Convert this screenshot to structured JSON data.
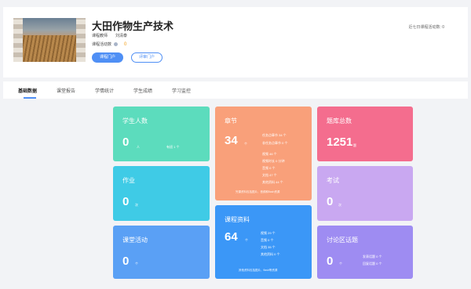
{
  "course": {
    "title": "大田作物生产技术",
    "teacher_label": "课程教师",
    "teacher_name": "刘清泰",
    "activity_label": "课程活动数",
    "activity_count": "0",
    "btn_course_portal": "课程门户",
    "btn_eval_portal": "评审门户",
    "recent_stat": "近七日课程活动数: 0"
  },
  "tabs": [
    "基础数据",
    "课堂报告",
    "学情统计",
    "学生成绩",
    "学习监控"
  ],
  "cards": {
    "students": {
      "title": "学生人数",
      "value": "0",
      "unit": "人",
      "sub": "有班 1 个"
    },
    "chapters": {
      "title": "章节",
      "value": "34",
      "unit": "个",
      "lines": [
        "任务点章节 34 个",
        "非任务点章节 0 个",
        "视频 46 个",
        "视频时长 0 分钟",
        "音频 0 个",
        "文档 47 个",
        "其他资料 44 个"
      ],
      "foot": "完课资料包括图片、音频和flash资源"
    },
    "question_bank": {
      "title": "题库总数",
      "value": "1251",
      "unit": "题"
    },
    "homework": {
      "title": "作业",
      "value": "0",
      "unit": "次"
    },
    "exam": {
      "title": "考试",
      "value": "0",
      "unit": "次"
    },
    "class_activity": {
      "title": "课堂活动",
      "value": "0",
      "unit": "个"
    },
    "resources": {
      "title": "课程资料",
      "value": "64",
      "unit": "个",
      "lines": [
        "视频 29 个",
        "音频 0 个",
        "文档 35 个",
        "其他资料 0 个"
      ],
      "foot": "其他资料包括图片、flash等资源"
    },
    "discussion": {
      "title": "讨论区话题",
      "value": "0",
      "unit": "个",
      "lines": [
        "发表话题 0 个",
        "回复话题 0 个"
      ]
    }
  },
  "colors": {
    "students": "#5cdcbd",
    "chapters": "#f9a07a",
    "question_bank": "#f46d8e",
    "homework": "#3fcbe6",
    "exam": "#c9a8f1",
    "class_activity": "#5aa0f5",
    "resources": "#3b97f7",
    "discussion": "#9e8cf2",
    "accent": "#4f8ff5"
  }
}
